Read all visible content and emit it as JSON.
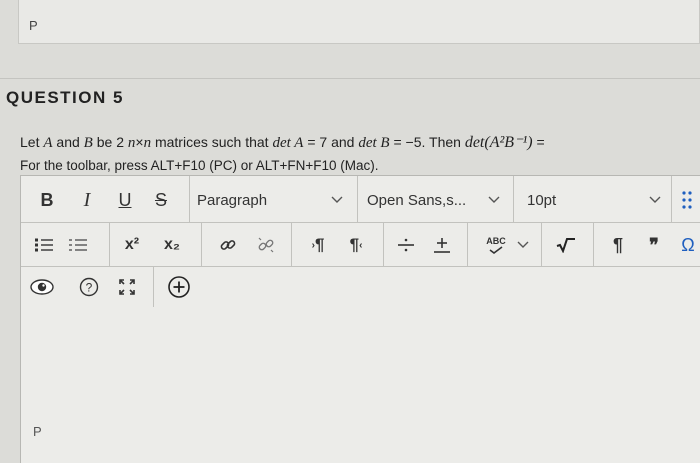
{
  "previous": {
    "paragraph_label": "P"
  },
  "question": {
    "title": "QUESTION 5",
    "text_pre": "Let",
    "var_a": "A",
    "text_and": "and",
    "var_b": "B",
    "text_be": "be 2",
    "var_n1": "n",
    "times": "×",
    "var_n2": "n",
    "text_matrices": "matrices such that",
    "det_a_expr": "det A",
    "det_a_val": "= 7",
    "text_and2": "and",
    "det_b_expr": "det B",
    "det_b_val": "= −5.",
    "text_then": "Then",
    "det_expr": "det(A²B⁻¹)",
    "text_eq": "="
  },
  "hint": "For the toolbar, press ALT+F10 (PC) or ALT+FN+F10 (Mac).",
  "toolbar": {
    "bold": "B",
    "italic": "I",
    "underline": "U",
    "strike": "S",
    "paragraph_select": "Paragraph",
    "font_select": "Open Sans,s...",
    "size_select": "10pt",
    "superscript": "x²",
    "subscript": "x₂",
    "ltr": "¶",
    "rtl": "¶",
    "spellcheck": "ABC",
    "pilcrow": "¶",
    "quote": "❞",
    "omega": "Ω"
  },
  "editor": {
    "paragraph_label": "P"
  }
}
